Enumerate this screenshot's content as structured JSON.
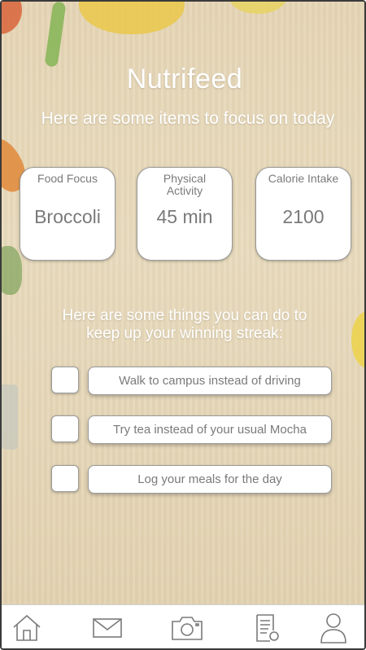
{
  "app": {
    "title": "Nutrifeed",
    "subtitle": "Here are some items to focus on today"
  },
  "focus_cards": [
    {
      "label": "Food Focus",
      "value": "Broccoli"
    },
    {
      "label": "Physical Activity",
      "value": "45 min"
    },
    {
      "label": "Calorie Intake",
      "value": "2100"
    }
  ],
  "streak": {
    "line1": "Here are some things you can do to",
    "line2": "keep up your winning streak:"
  },
  "tasks": [
    {
      "label": "Walk to campus instead of driving",
      "checked": false
    },
    {
      "label": "Try tea instead of your usual Mocha",
      "checked": false
    },
    {
      "label": "Log your meals for the day",
      "checked": false
    }
  ],
  "nav": {
    "icons": [
      "home-icon",
      "mail-icon",
      "camera-icon",
      "list-icon",
      "profile-icon"
    ]
  }
}
